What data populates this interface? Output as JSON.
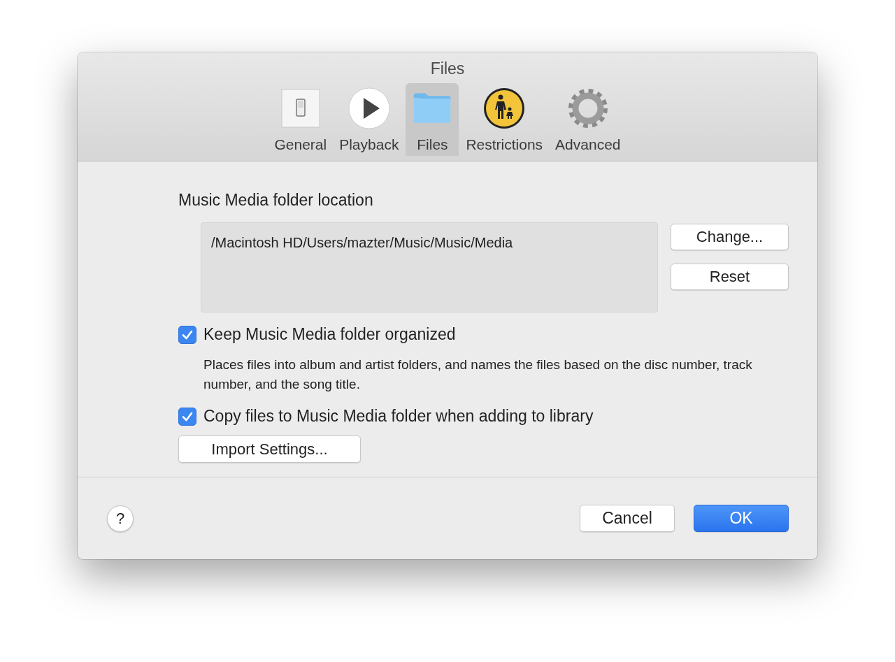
{
  "window": {
    "title": "Files"
  },
  "tabs": [
    {
      "label": "General",
      "kind": "switch",
      "selected": false
    },
    {
      "label": "Playback",
      "kind": "play",
      "selected": false
    },
    {
      "label": "Files",
      "kind": "folder",
      "selected": true
    },
    {
      "label": "Restrictions",
      "kind": "parental",
      "selected": false
    },
    {
      "label": "Advanced",
      "kind": "gear",
      "selected": false
    }
  ],
  "location": {
    "heading": "Music Media folder location",
    "path": "/Macintosh HD/Users/mazter/Music/Music/Media",
    "buttons": [
      "Change...",
      "Reset"
    ]
  },
  "options": [
    {
      "label": "Keep Music Media folder organized",
      "checked": true,
      "description": "Places files into album and artist folders, and names the files based on the disc number, track number, and the song title."
    },
    {
      "label": "Copy files to Music Media folder when adding to library",
      "checked": true
    }
  ],
  "import_button": "Import Settings...",
  "footer": {
    "help": "?",
    "buttons": [
      {
        "label": "Cancel",
        "kind": "normal"
      },
      {
        "label": "OK",
        "kind": "default"
      }
    ]
  }
}
